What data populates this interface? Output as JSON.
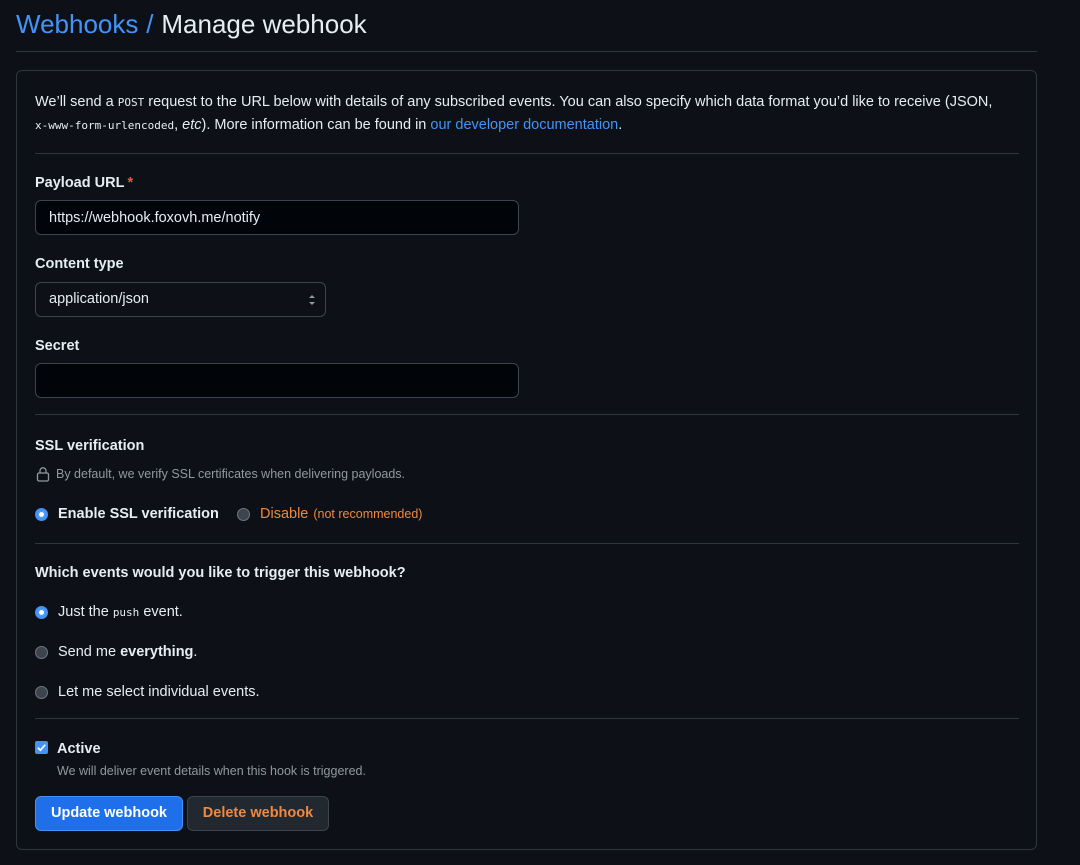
{
  "header": {
    "breadcrumb_parent": "Webhooks",
    "separator": "/",
    "title": "Manage webhook"
  },
  "intro": {
    "text1": "We’ll send a ",
    "method": "POST",
    "text2": " request to the URL below with details of any subscribed events. You can also specify which data format you’d like to receive (JSON, ",
    "format_code": "x-www-form-urlencoded",
    "text3": ", ",
    "etc": "etc",
    "text4": "). More information can be found in ",
    "link": "our developer documentation",
    "text5": "."
  },
  "payload_url": {
    "label": "Payload URL",
    "required_mark": "*",
    "value": "https://webhook.foxovh.me/notify"
  },
  "content_type": {
    "label": "Content type",
    "selected": "application/json"
  },
  "secret": {
    "label": "Secret",
    "value": ""
  },
  "ssl": {
    "label": "SSL verification",
    "hint": "By default, we verify SSL certificates when delivering payloads.",
    "enable_label": "Enable SSL verification",
    "disable_label": "Disable",
    "disable_note": "(not recommended)"
  },
  "events": {
    "label": "Which events would you like to trigger this webhook?",
    "option1_pre": "Just the ",
    "option1_code": "push",
    "option1_post": " event.",
    "option2_pre": "Send me ",
    "option2_bold": "everything",
    "option2_post": ".",
    "option3": "Let me select individual events."
  },
  "active": {
    "label": "Active",
    "note": "We will deliver event details when this hook is triggered.",
    "checked": true
  },
  "buttons": {
    "update": "Update webhook",
    "delete": "Delete webhook"
  },
  "colors": {
    "background": "#0d1117",
    "accent": "#4493f8",
    "primary_button": "#1f6feb",
    "danger_text": "#f0883e",
    "required": "#f85149"
  }
}
